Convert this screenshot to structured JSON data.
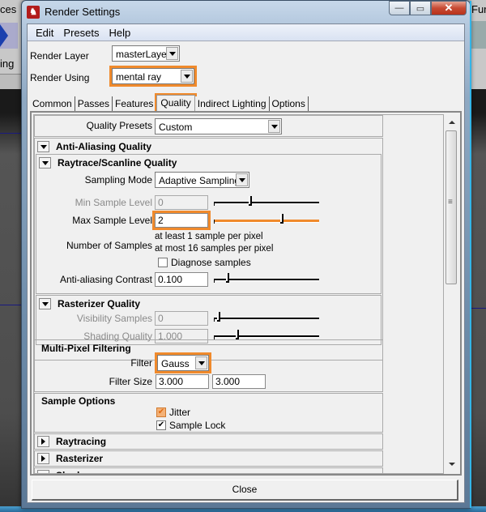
{
  "background": {
    "left_top_label": "ces",
    "left_mid_label": "ing",
    "right_top_label": "Fur"
  },
  "window": {
    "title": "Render Settings",
    "controls": {
      "minimize": "—",
      "maximize": "▭",
      "close": "✕"
    }
  },
  "menu": [
    "Edit",
    "Presets",
    "Help"
  ],
  "render_layer": {
    "label": "Render Layer",
    "value": "masterLayer"
  },
  "render_using": {
    "label": "Render Using",
    "value": "mental ray"
  },
  "tabs": [
    {
      "label": "Common",
      "active": false
    },
    {
      "label": "Passes",
      "active": false
    },
    {
      "label": "Features",
      "active": false
    },
    {
      "label": "Quality",
      "active": true
    },
    {
      "label": "Indirect Lighting",
      "active": false
    },
    {
      "label": "Options",
      "active": false
    }
  ],
  "quality_presets": {
    "label": "Quality Presets",
    "value": "Custom"
  },
  "sections": {
    "anti_aliasing": "Anti-Aliasing Quality",
    "raytrace_scanline": "Raytrace/Scanline Quality",
    "rasterizer_quality": "Rasterizer Quality",
    "multi_pixel": "Multi-Pixel Filtering",
    "sample_options": "Sample Options",
    "raytracing": "Raytracing",
    "rasterizer": "Rasterizer",
    "shadows_partial": "Shad..."
  },
  "raytrace": {
    "sampling_mode": {
      "label": "Sampling Mode",
      "value": "Adaptive Sampling"
    },
    "min_sample_level": {
      "label": "Min Sample Level",
      "value": "0",
      "slider_fraction": 0.35,
      "enabled": false
    },
    "max_sample_level": {
      "label": "Max Sample Level",
      "value": "2",
      "slider_fraction": 0.66,
      "enabled": true
    },
    "number_of_samples": {
      "label": "Number of Samples",
      "line1": "at least 1 sample per pixel",
      "line2": "at most 16 samples per pixel"
    },
    "diagnose_samples": {
      "label": "Diagnose samples",
      "checked": false
    },
    "aa_contrast": {
      "label": "Anti-aliasing Contrast",
      "value": "0.100",
      "slider_fraction": 0.12,
      "enabled": true
    }
  },
  "rasterizer_quality": {
    "visibility_samples": {
      "label": "Visibility Samples",
      "value": "0",
      "slider_fraction": 0.03,
      "enabled": false
    },
    "shading_quality": {
      "label": "Shading Quality",
      "value": "1.000",
      "slider_fraction": 0.22,
      "enabled": false
    }
  },
  "filtering": {
    "filter": {
      "label": "Filter",
      "value": "Gauss"
    },
    "filter_size": {
      "label": "Filter Size",
      "x": "3.000",
      "y": "3.000"
    }
  },
  "sample_options": {
    "jitter": {
      "label": "Jitter",
      "checked": true
    },
    "sample_lock": {
      "label": "Sample Lock",
      "checked": true
    }
  },
  "accent_color": "#f08a2c",
  "close_button": "Close"
}
